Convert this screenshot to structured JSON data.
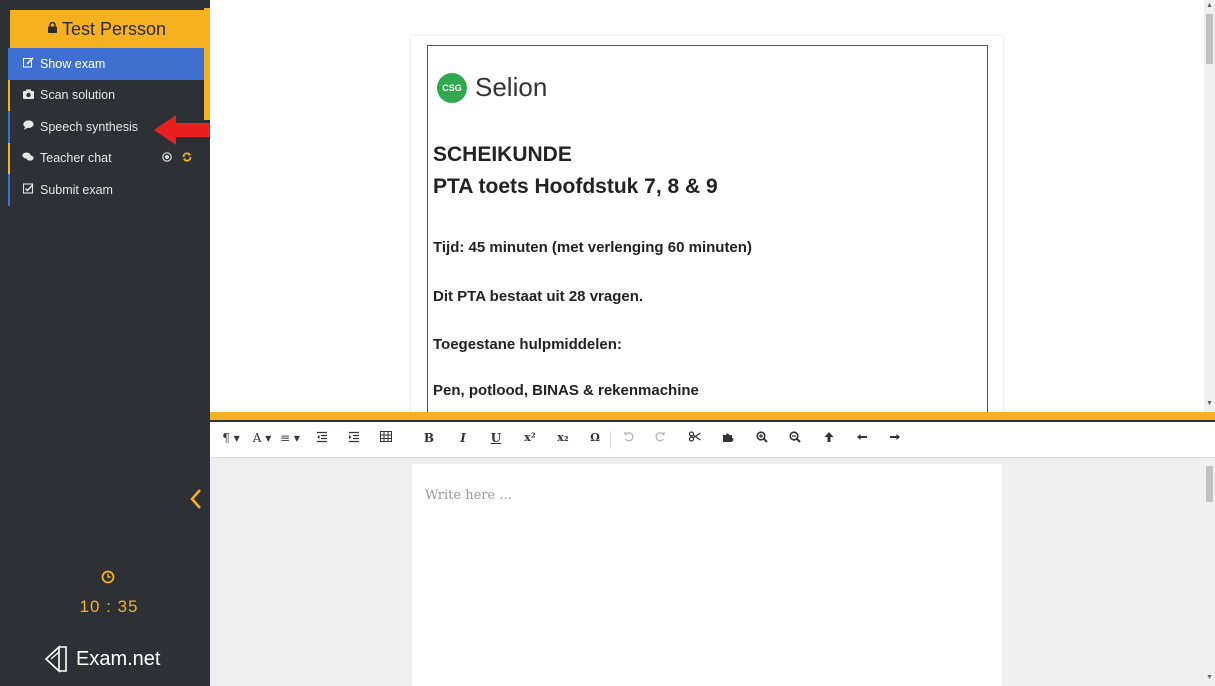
{
  "user": {
    "name": "Test Persson",
    "icon": "lock-icon"
  },
  "menu": [
    {
      "label": "Show exam",
      "icon": "edit-icon"
    },
    {
      "label": "Scan solution",
      "icon": "camera-icon"
    },
    {
      "label": "Speech synthesis",
      "icon": "speech-bubble-icon"
    },
    {
      "label": "Teacher chat",
      "icon": "chat-icon"
    },
    {
      "label": "Submit exam",
      "icon": "checkbox-icon"
    }
  ],
  "timer": {
    "value": "10 : 35"
  },
  "brand": {
    "name": "Exam.net"
  },
  "exam": {
    "school_badge": "CSG",
    "school_name": "Selion",
    "subject": "SCHEIKUNDE",
    "title": "PTA toets Hoofdstuk 7, 8 & 9",
    "lines": [
      "Tijd: 45 minuten (met verlenging 60 minuten)",
      "Dit PTA bestaat uit 28 vragen.",
      "Toegestane hulpmiddelen:",
      "Pen, potlood, BINAS & rekenmachine"
    ]
  },
  "editor": {
    "placeholder": "Write here ..."
  },
  "toolbar": {
    "paragraph": "¶ ▾",
    "font": "A ▾",
    "align": "≡ ▾",
    "bold": "B",
    "italic": "I",
    "underline": "U",
    "superscript": "x²",
    "subscript": "x₂",
    "special_char": "Ω"
  },
  "colors": {
    "accent": "#f6b121",
    "sidebar": "#2d3034",
    "active": "#3f6fd0",
    "annotation_arrow": "#e82020",
    "csg_green": "#2fa84f"
  }
}
